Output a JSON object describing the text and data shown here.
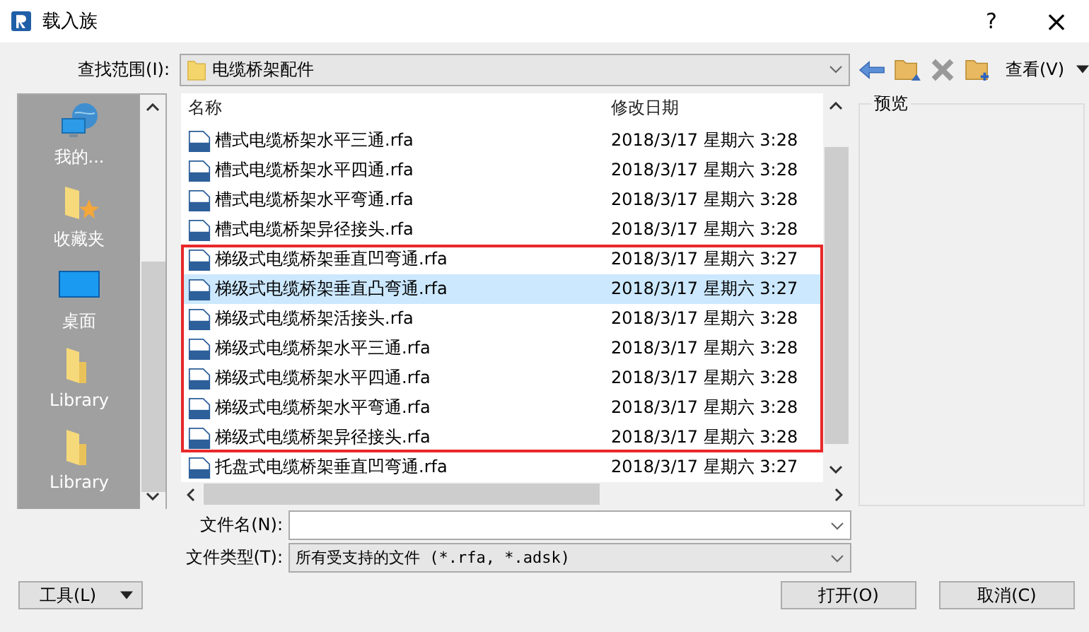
{
  "window": {
    "title": "载入族",
    "help": "?",
    "close": "×"
  },
  "look_in": {
    "label": "查找范围(I):",
    "value": "电缆桥架配件"
  },
  "toolbar": {
    "view_label": "查看(V)"
  },
  "places": [
    {
      "label": "我的...",
      "kind": "network"
    },
    {
      "label": "收藏夹",
      "kind": "favorites"
    },
    {
      "label": "桌面",
      "kind": "desktop"
    },
    {
      "label": "Library",
      "kind": "folder"
    },
    {
      "label": "Library",
      "kind": "folder"
    }
  ],
  "file_list": {
    "columns": [
      "名称",
      "修改日期"
    ],
    "rows": [
      {
        "name": "槽式电缆桥架水平三通.rfa",
        "date": "2018/3/17 星期六 3:28",
        "selected": false,
        "marked": false
      },
      {
        "name": "槽式电缆桥架水平四通.rfa",
        "date": "2018/3/17 星期六 3:28",
        "selected": false,
        "marked": false
      },
      {
        "name": "槽式电缆桥架水平弯通.rfa",
        "date": "2018/3/17 星期六 3:28",
        "selected": false,
        "marked": false
      },
      {
        "name": "槽式电缆桥架异径接头.rfa",
        "date": "2018/3/17 星期六 3:28",
        "selected": false,
        "marked": false
      },
      {
        "name": "梯级式电缆桥架垂直凹弯通.rfa",
        "date": "2018/3/17 星期六 3:27",
        "selected": false,
        "marked": true
      },
      {
        "name": "梯级式电缆桥架垂直凸弯通.rfa",
        "date": "2018/3/17 星期六 3:27",
        "selected": true,
        "marked": true
      },
      {
        "name": "梯级式电缆桥架活接头.rfa",
        "date": "2018/3/17 星期六 3:28",
        "selected": false,
        "marked": true
      },
      {
        "name": "梯级式电缆桥架水平三通.rfa",
        "date": "2018/3/17 星期六 3:28",
        "selected": false,
        "marked": true
      },
      {
        "name": "梯级式电缆桥架水平四通.rfa",
        "date": "2018/3/17 星期六 3:28",
        "selected": false,
        "marked": true
      },
      {
        "name": "梯级式电缆桥架水平弯通.rfa",
        "date": "2018/3/17 星期六 3:28",
        "selected": false,
        "marked": true
      },
      {
        "name": "梯级式电缆桥架异径接头.rfa",
        "date": "2018/3/17 星期六 3:28",
        "selected": false,
        "marked": true
      },
      {
        "name": "托盘式电缆桥架垂直凹弯通.rfa",
        "date": "2018/3/17 星期六 3:27",
        "selected": false,
        "marked": false
      }
    ]
  },
  "preview": {
    "label": "预览"
  },
  "file_name": {
    "label": "文件名(N):"
  },
  "file_type": {
    "label": "文件类型(T):",
    "value": "所有受支持的文件 (*.rfa, *.adsk)"
  },
  "buttons": {
    "tools": "工具(L)",
    "open": "打开(O)",
    "cancel": "取消(C)"
  }
}
